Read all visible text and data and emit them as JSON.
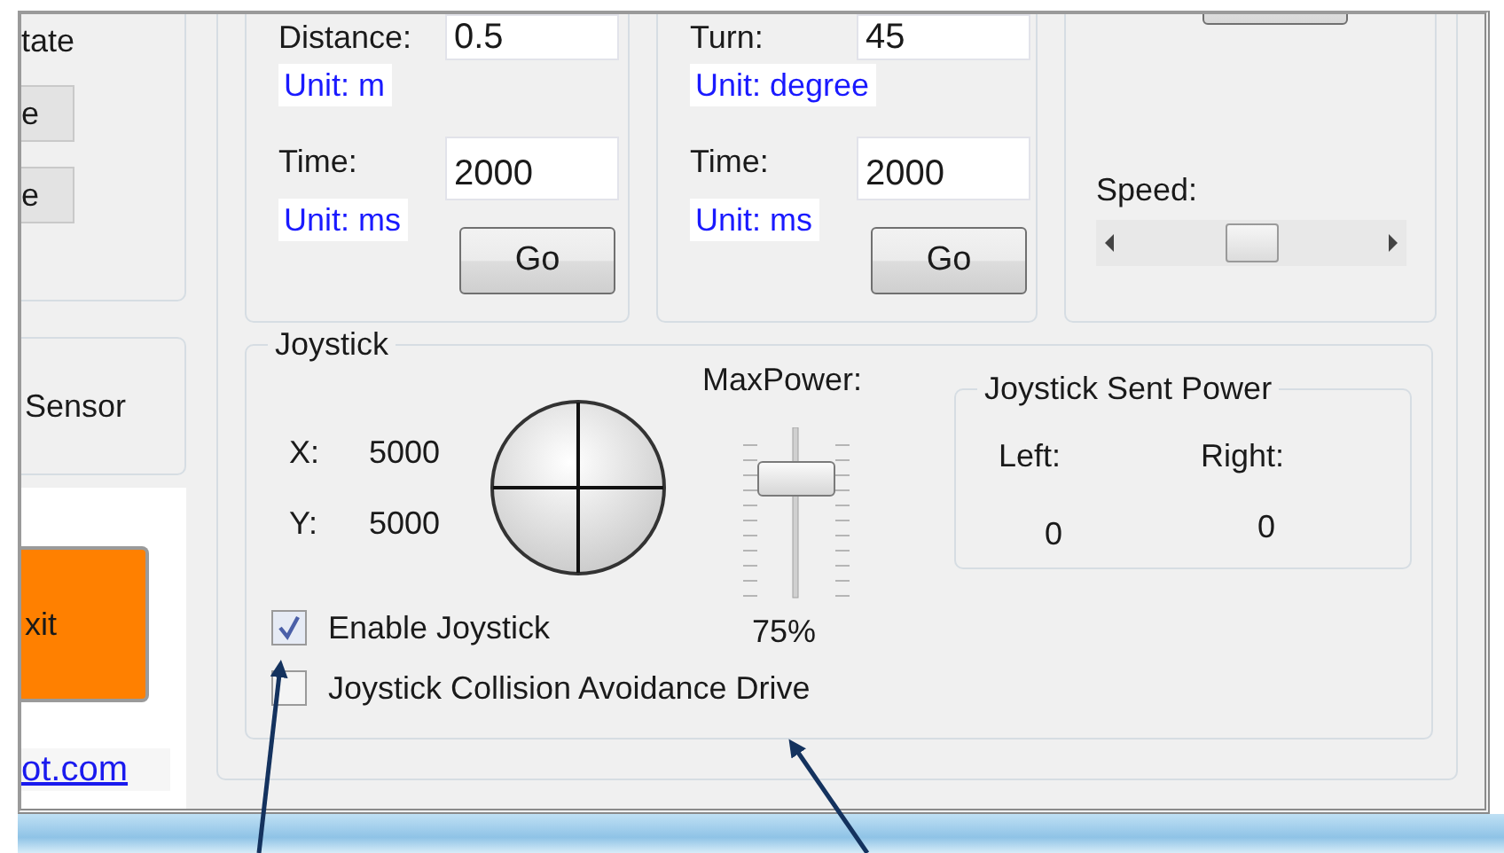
{
  "left_panel": {
    "group_title": "tate",
    "buttons": [
      "e",
      "e"
    ],
    "sensor_label": "Sensor",
    "exit_button": "xit",
    "link": "ot.com"
  },
  "motion_groups": [
    {
      "label": "Distance:",
      "value": "0.5",
      "unit": "Unit: m",
      "time_label": "Time:",
      "time_value": "2000",
      "time_unit": "Unit: ms",
      "button": "Go"
    },
    {
      "label": "Turn:",
      "value": "45",
      "unit": "Unit: degree",
      "time_label": "Time:",
      "time_value": "2000",
      "time_unit": "Unit: ms",
      "button": "Go"
    }
  ],
  "speed_group": {
    "label": "Speed:",
    "level": 0.5
  },
  "joystick": {
    "title": "Joystick",
    "x_label": "X:",
    "x_value": "5000",
    "y_label": "Y:",
    "y_value": "5000",
    "max_power_label": "MaxPower:",
    "max_power": {
      "level": 0.75
    },
    "max_power_reading": "75%",
    "sent_power": {
      "title": "Joystick Sent Power",
      "left_label": "Left:",
      "right_label": "Right:",
      "left_value": "0",
      "right_value": "0"
    },
    "checkboxes": [
      {
        "label": "Enable Joystick",
        "checked": true
      },
      {
        "label": "Joystick Collision Avoidance Drive",
        "checked": false
      }
    ]
  }
}
